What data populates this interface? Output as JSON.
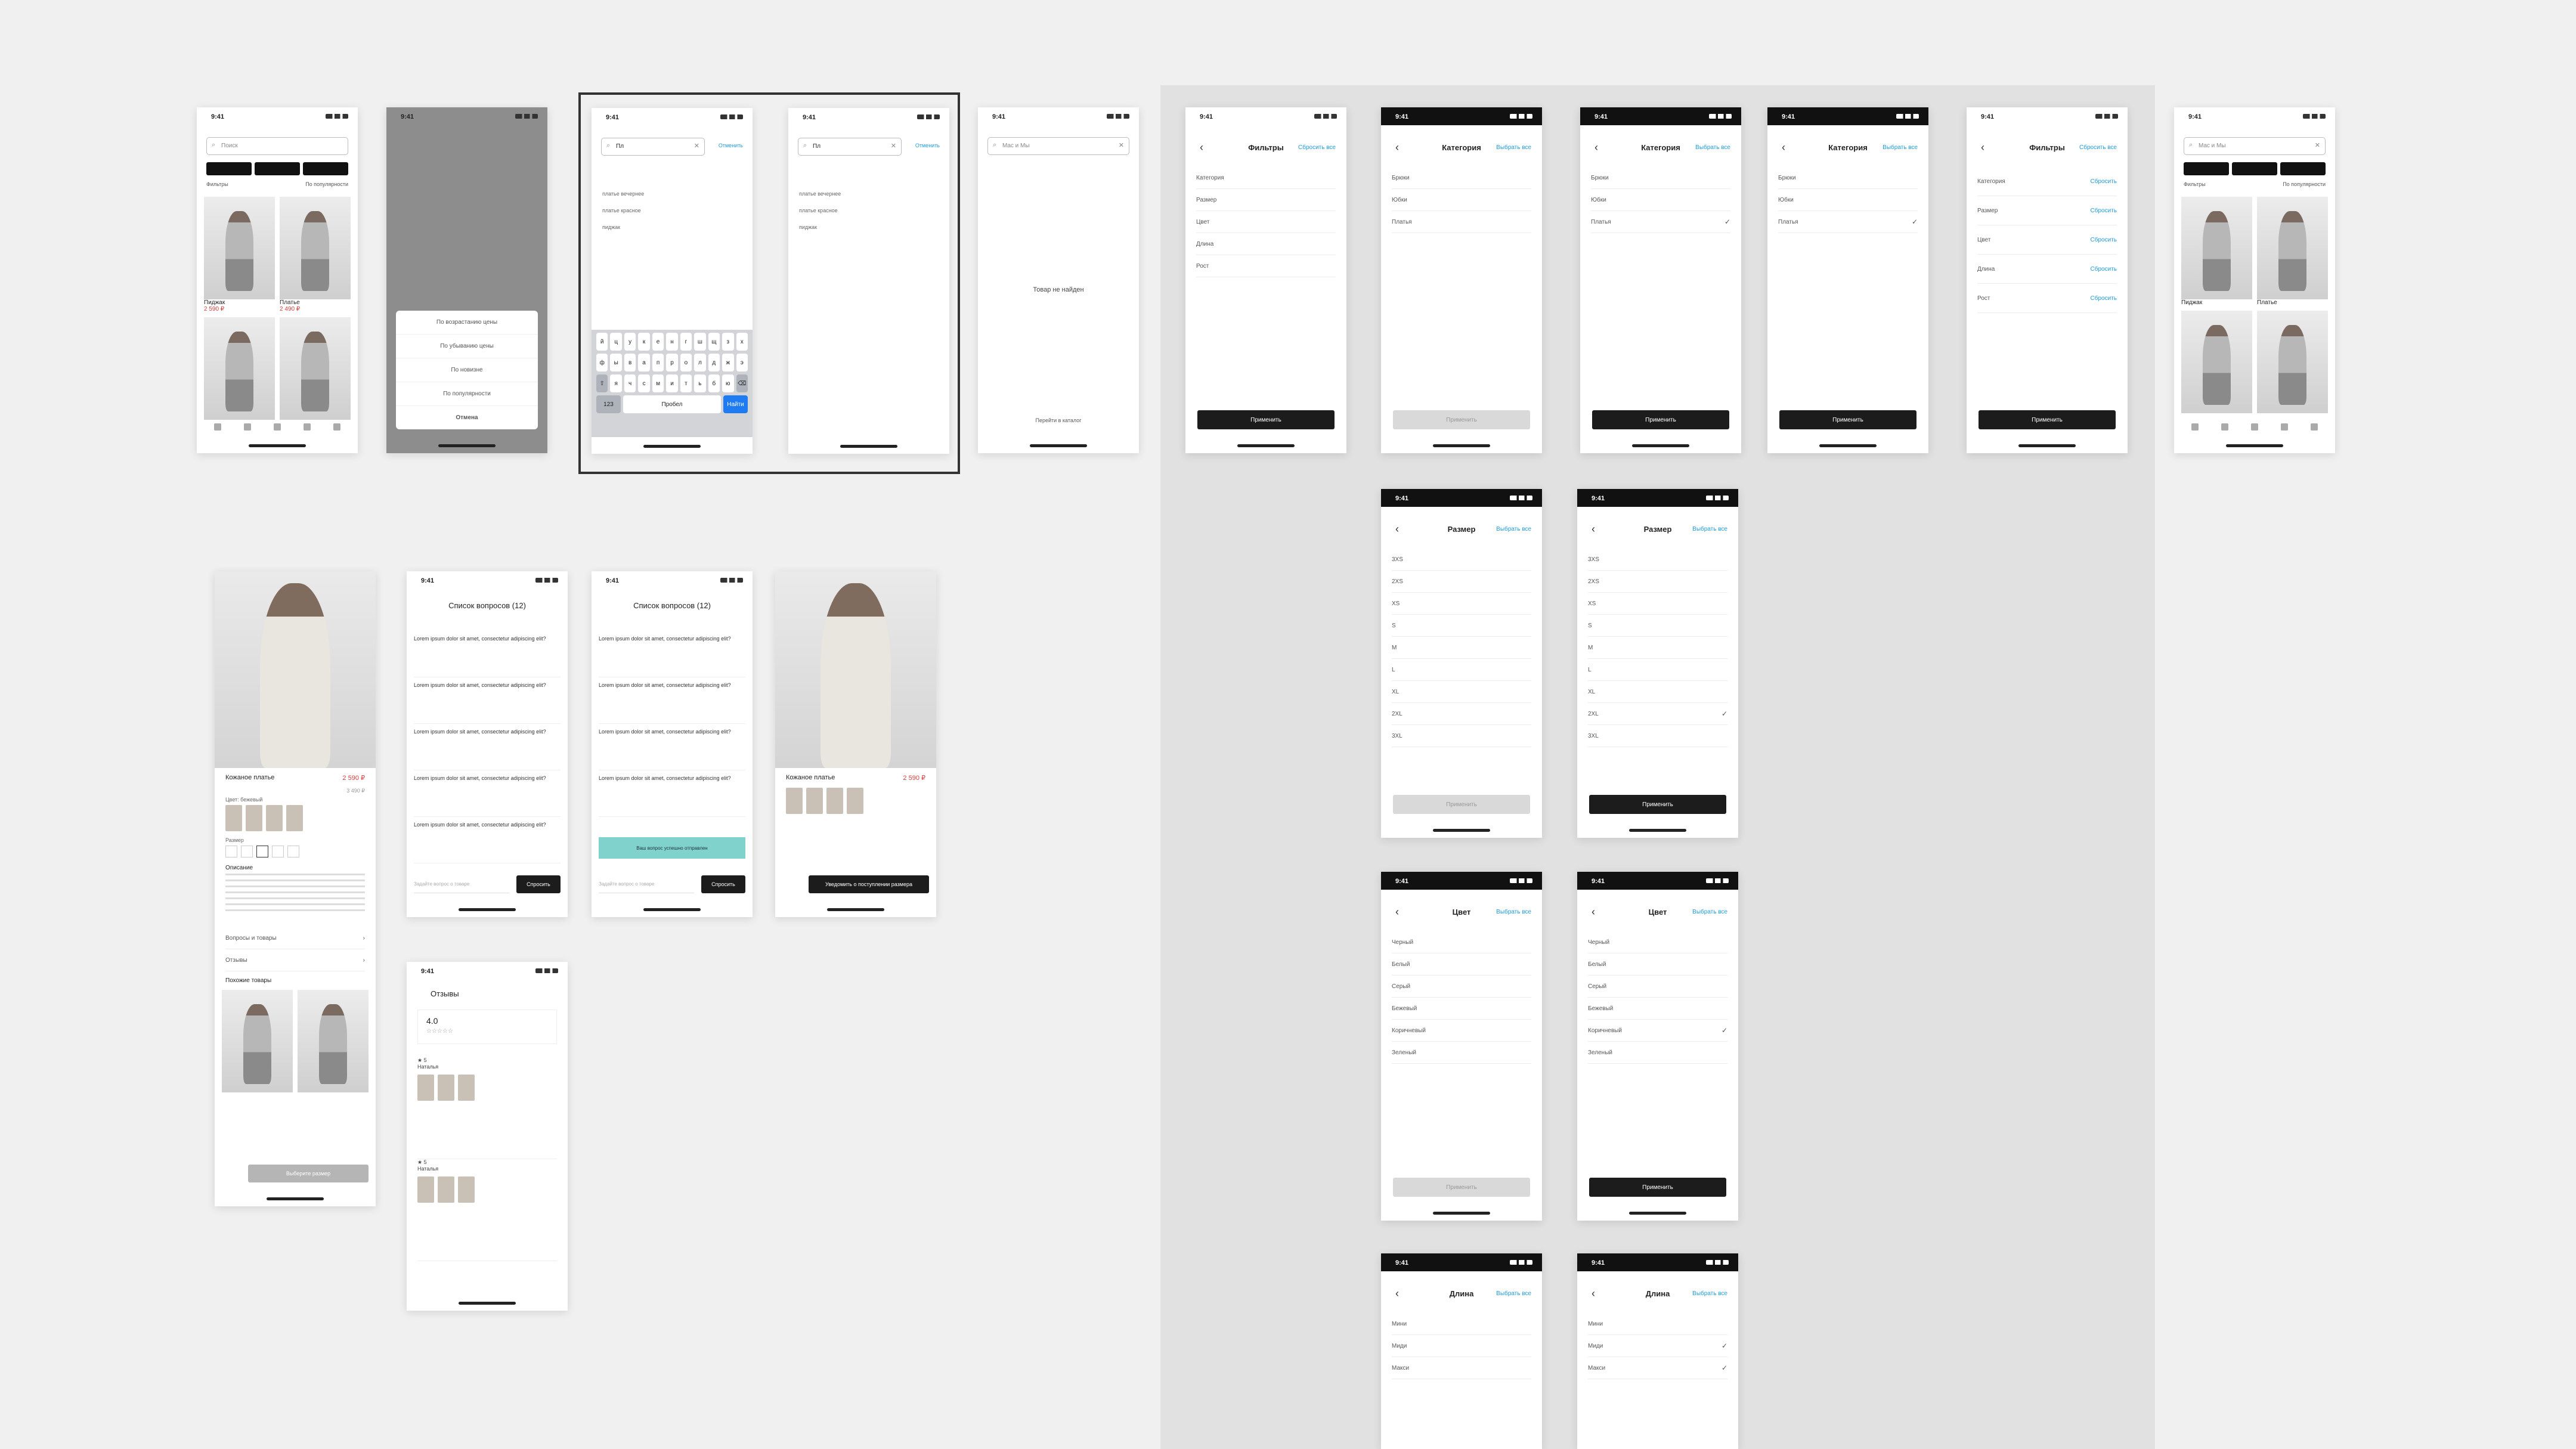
{
  "status": {
    "time": "9:41"
  },
  "catalog": {
    "search_placeholder": "Поиск",
    "filters_label": "Фильтры",
    "sort_label": "По популярности",
    "items": [
      {
        "name": "Пиджак",
        "price": "2 590 ₽"
      },
      {
        "name": "Платье",
        "price": "2 490 ₽"
      }
    ]
  },
  "sort_sheet": {
    "options": [
      "По возрастанию цены",
      "По убыванию цены",
      "По новизне",
      "По популярности"
    ],
    "cancel": "Отмена"
  },
  "search": {
    "query": "Пл",
    "cancel": "Отменить",
    "suggestions": [
      "платье вечернее",
      "платье красное",
      "пиджак"
    ],
    "keyboard_rows": [
      [
        "й",
        "ц",
        "у",
        "к",
        "е",
        "н",
        "г",
        "ш",
        "щ",
        "з",
        "х"
      ],
      [
        "ф",
        "ы",
        "в",
        "а",
        "п",
        "р",
        "о",
        "л",
        "д",
        "ж",
        "э"
      ],
      [
        "⇧",
        "я",
        "ч",
        "с",
        "м",
        "и",
        "т",
        "ь",
        "б",
        "ю",
        "⌫"
      ]
    ],
    "key_123": "123",
    "key_space": "Пробел",
    "key_find": "Найти"
  },
  "empty": {
    "query": "Mac и Мы",
    "message": "Товар не найден",
    "link": "Перейти в каталог"
  },
  "filters": {
    "title": "Фильтры",
    "reset_all": "Сбросить все",
    "reset": "Сбросить",
    "rows": [
      "Категория",
      "Размер",
      "Цвет",
      "Длина",
      "Рост"
    ],
    "apply": "Применить"
  },
  "category": {
    "title": "Категория",
    "link": "Выбрать все",
    "rows": [
      "Брюки",
      "Юбки",
      "Платья"
    ]
  },
  "size": {
    "title": "Размер",
    "link": "Выбрать все",
    "rows": [
      "3XS",
      "2XS",
      "XS",
      "S",
      "M",
      "L",
      "XL",
      "2XL",
      "3XL"
    ]
  },
  "color": {
    "title": "Цвет",
    "link": "Выбрать все",
    "rows": [
      "Черный",
      "Белый",
      "Серый",
      "Бежевый",
      "Коричневый",
      "Зеленый"
    ]
  },
  "length": {
    "title": "Длина",
    "link": "Выбрать все",
    "rows": [
      "Мини",
      "Миди",
      "Макси"
    ]
  },
  "product": {
    "name": "Кожаное платье",
    "price": "2 590 ₽",
    "old_price": "3 490 ₽",
    "color_label": "Цвет: бежевый",
    "size_label": "Размер",
    "description_label": "Описание",
    "questions_link": "Вопросы и товары",
    "reviews_link": "Отзывы",
    "similar_label": "Похожие товары",
    "add_button": "Выберите размер",
    "notify_button": "Уведомить о поступлении размера"
  },
  "questions": {
    "title": "Список вопросов (12)",
    "text": "Lorem ipsum dolor sit amet, consectetur adipiscing elit?",
    "input_placeholder": "Задайте вопрос о товаре",
    "ask_button": "Спросить",
    "toast": "Ваш вопрос успешно отправлен"
  },
  "reviews": {
    "title": "Отзывы",
    "rating": "4.0",
    "reviewer": "Наталья"
  },
  "colors": {
    "accent": "#1e9bd7",
    "dark": "#1c1c1c",
    "toast": "#7fd3cc"
  }
}
